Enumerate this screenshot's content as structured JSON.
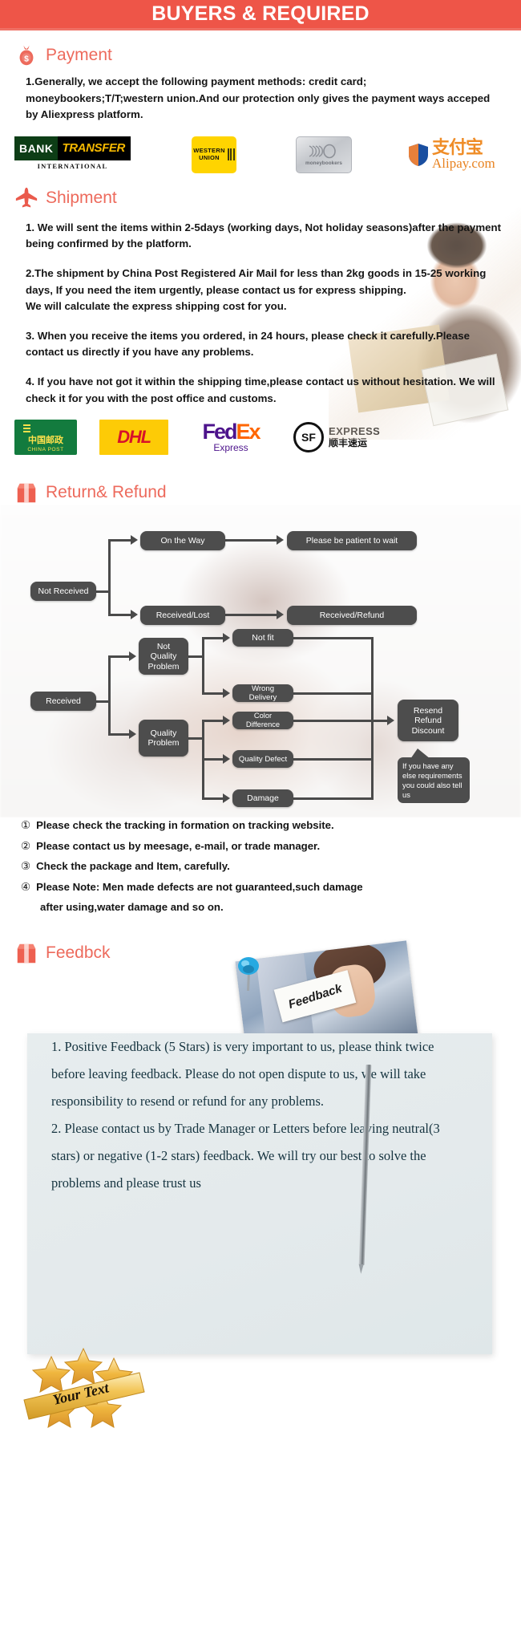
{
  "banner": {
    "title": "BUYERS & REQUIRED"
  },
  "sections": {
    "payment": {
      "heading": "Payment",
      "icon": "money-bag-icon",
      "paragraph": "1.Generally, we accept the following payment methods: credit card; moneybookers;T/T;western union.And our protection only gives the payment ways acceped by Aliexpress platform.",
      "logos": [
        {
          "name": "bank-transfer-logo",
          "line1": "BANK",
          "line2": "TRANSFER",
          "line3": "INTERNATIONAL"
        },
        {
          "name": "western-union-logo",
          "line1": "WESTERN",
          "line2": "UNION"
        },
        {
          "name": "moneybookers-logo",
          "line1": "moneybookers"
        },
        {
          "name": "alipay-logo",
          "line1": "支付宝",
          "line2": "Alipay.com"
        }
      ]
    },
    "shipment": {
      "heading": "Shipment",
      "icon": "airplane-icon",
      "paragraphs": [
        "1. We will sent the items within 2-5days (working days, Not holiday seasons)after the payment being confirmed by the platform.",
        "2.The shipment by China Post Registered Air Mail for less than  2kg goods in 15-25 working days, If  you need the item urgently, please contact us for express shipping.",
        "We will calculate the express shipping cost for you.",
        "3. When you receive the items you ordered, in 24 hours, please check it carefully.Please contact us directly if you have any problems.",
        "4. If you have not got it within the shipping time,please contact us without hesitation. We will check it for you with the post office and customs."
      ],
      "carriers": [
        {
          "name": "china-post-logo",
          "cn": "中国邮政",
          "en": "CHINA POST"
        },
        {
          "name": "dhl-logo",
          "text": "DHL"
        },
        {
          "name": "fedex-logo",
          "part1": "Fed",
          "part2": "Ex",
          "sub": "Express"
        },
        {
          "name": "sf-express-logo",
          "badge": "SF",
          "en": "EXPRESS",
          "cn": "顺丰速运"
        }
      ]
    },
    "return_refund": {
      "heading": "Return& Refund",
      "icon": "return-box-icon",
      "flow_top": {
        "root": "Not Received",
        "branches": [
          {
            "label": "On the Way",
            "result": "Please be patient to wait"
          },
          {
            "label": "Received/Lost",
            "result": "Received/Refund"
          }
        ]
      },
      "flow_bottom": {
        "root": "Received",
        "groups": [
          {
            "label": "Not\nQuality\nProblem",
            "items": [
              "Not fit",
              "Wrong Delivery"
            ]
          },
          {
            "label": "Quality\nProblem",
            "items": [
              "Color Difference",
              "Quality Defect",
              "Damage"
            ]
          }
        ],
        "result": "Resend\nRefund\nDiscount",
        "callout": "If you have any else requirements you could also tell us"
      },
      "notes": [
        {
          "num": "①",
          "text": "Please check the tracking in formation on tracking website."
        },
        {
          "num": "②",
          "text": "Please contact us by meesage, e-mail, or trade manager."
        },
        {
          "num": "③",
          "text": "Check the package and Item, carefully."
        },
        {
          "num": "④",
          "text": "Please Note: Men made defects  are not guaranteed,such damage"
        }
      ],
      "notes_continuation": "after using,water damage and so on."
    },
    "feedback": {
      "heading": "Feedbck",
      "icon": "feedback-box-icon",
      "photo_card_text": "Feedback",
      "paragraphs": [
        "1. Positive Feedback (5 Stars) is very important to us, please think twice before leaving feedback. Please do not open dispute to us,   we will take responsibility to resend or refund for any problems.",
        "2. Please contact us by Trade Manager or Letters before leaving neutral(3 stars) or negative (1-2 stars) feedback. We will try our best to solve the problems and please trust us"
      ],
      "badge_text": "Your Text"
    }
  },
  "colors": {
    "banner_bg": "#ee5548",
    "banner_underline": "#ef7065",
    "heading": "#ed6a5c",
    "node_bg": "#4d4d4d",
    "body_text": "#151515",
    "feedback_panel": "#e5ebec",
    "feedback_text": "#15333f"
  }
}
